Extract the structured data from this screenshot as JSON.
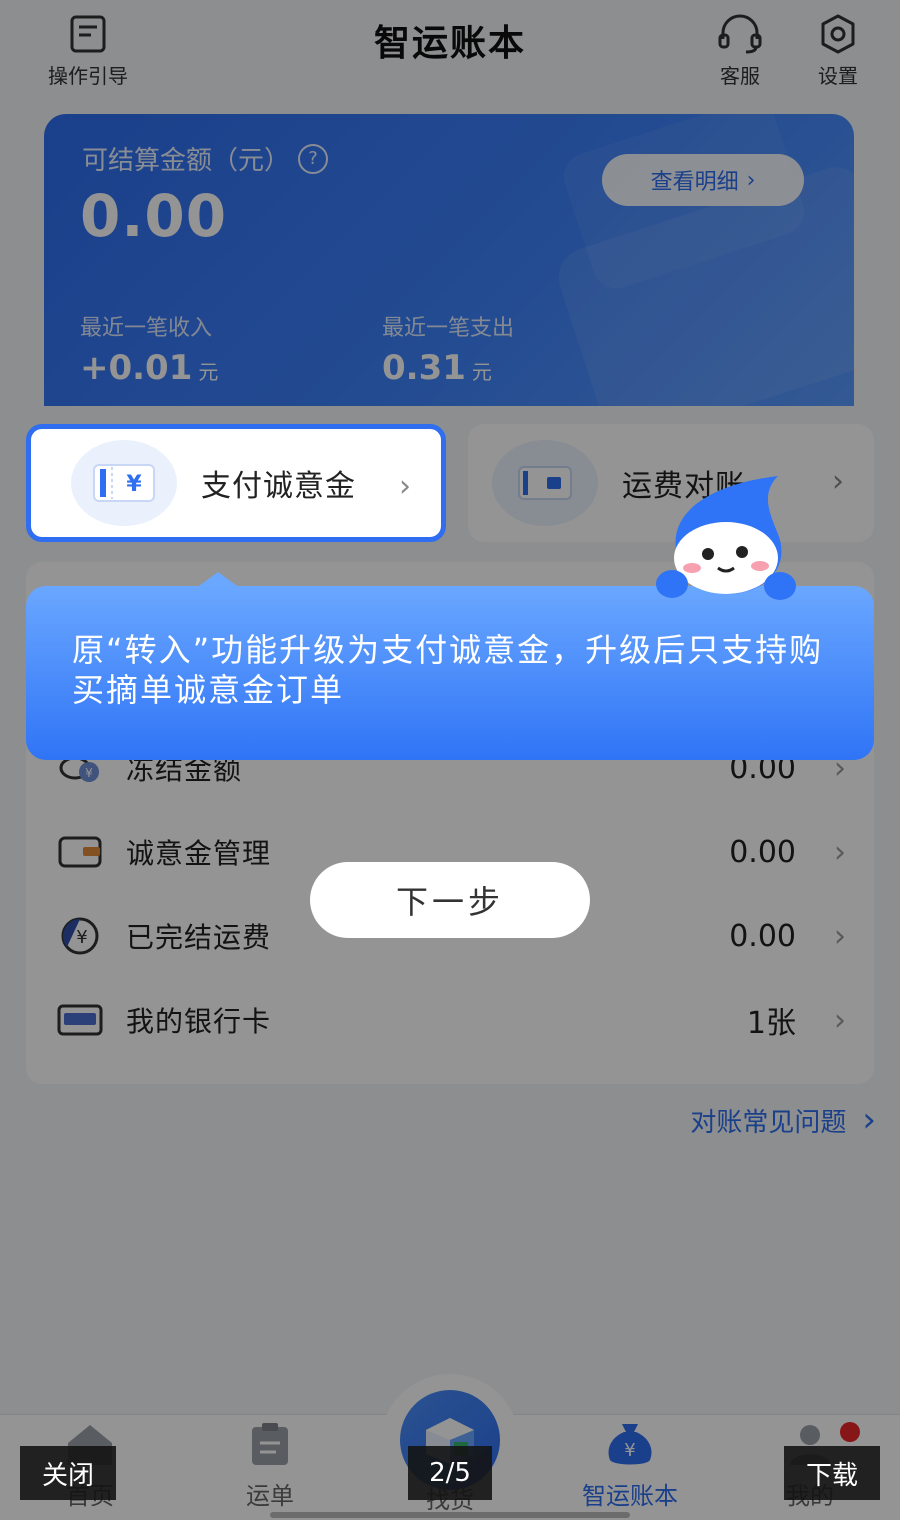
{
  "header": {
    "title": "智运账本",
    "guide_label": "操作引导",
    "service_label": "客服",
    "settings_label": "设置"
  },
  "balance": {
    "label": "可结算金额（元）",
    "value": "0.00",
    "detail_button": "查看明细",
    "last_income_label": "最近一笔收入",
    "last_income_value": "+0.01",
    "last_expense_label": "最近一笔支出",
    "last_expense_value": "0.31",
    "unit": "元"
  },
  "quick_actions": {
    "pay_deposit": "支付诚意金",
    "freight_reconcile": "运费对账"
  },
  "list": [
    {
      "label": "冻结金额",
      "value": "0.00"
    },
    {
      "label": "诚意金管理",
      "value": "0.00"
    },
    {
      "label": "已完结运费",
      "value": "0.00"
    },
    {
      "label": "我的银行卡",
      "value": "1张"
    }
  ],
  "faq_link": "对账常见问题",
  "guide_overlay": {
    "tooltip": "原“转入”功能升级为支付诚意金，升级后只支持购买摘单诚意金订单",
    "next_button": "下一步"
  },
  "tabs": {
    "home": "首页",
    "orders": "运单",
    "goods": "找货",
    "account": "智运账本",
    "mine": "我的"
  },
  "viewer": {
    "close": "关闭",
    "counter": "2/5",
    "download": "下载"
  },
  "colors": {
    "accent": "#2f6ef0",
    "badge": "#e8262b"
  }
}
